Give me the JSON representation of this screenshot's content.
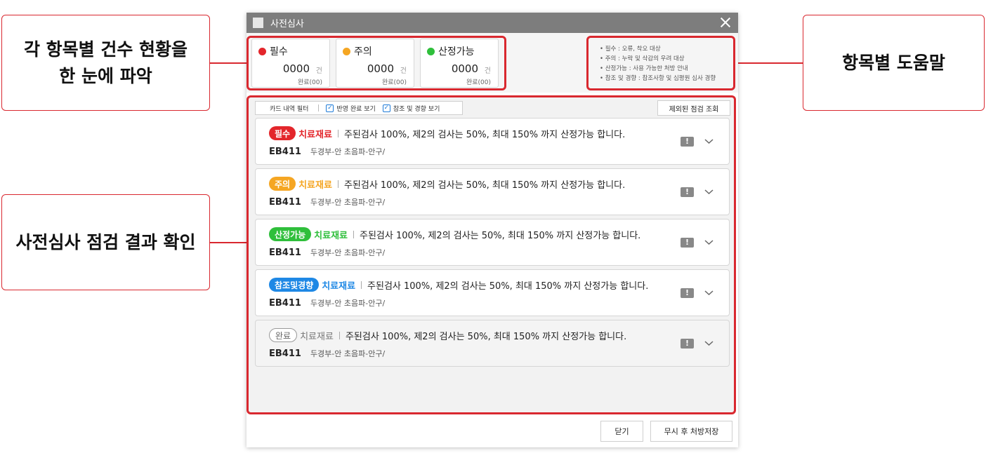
{
  "callouts": {
    "counts": [
      "각 항목별 건수 현황을",
      "한 눈에 파악"
    ],
    "results": "사전심사 점검 결과 확인",
    "help": "항목별 도움말"
  },
  "window": {
    "title": "사전심사"
  },
  "counts": [
    {
      "label": "필수",
      "color": "#e3262b",
      "count": "0000",
      "unit": "건",
      "done": "완료(00)"
    },
    {
      "label": "주의",
      "color": "#f5a623",
      "count": "0000",
      "unit": "건",
      "done": "완료(00)"
    },
    {
      "label": "산정가능",
      "color": "#2fbf3b",
      "count": "0000",
      "unit": "건",
      "done": "완료(00)"
    }
  ],
  "help": [
    "• 필수 : 오류, 착오 대상",
    "• 주의 : 누락 및 삭감의 우려 대상",
    "• 산정가능 : 사용 가능한 처방 안내",
    "• 참조 및 경향 : 참조사항 및 심평원 심사 경향"
  ],
  "filter": {
    "label": "카드 내역 필터",
    "check1": "반영 완료 보기",
    "check2": "참조 및 경향 보기",
    "check_mark": "✓"
  },
  "excluded_button": "제외된 점검 조회",
  "cards": [
    {
      "badge": "필수",
      "badge_color": "#e3262b",
      "cat": "치료재료",
      "cat_color": "#e3262b",
      "msg": "주된검사 100%, 제2의 검사는 50%, 최대 150% 까지 산정가능 합니다.",
      "code": "EB411",
      "desc": "두경부-안 초음파-안구/",
      "alert": "!"
    },
    {
      "badge": "주의",
      "badge_color": "#f5a623",
      "cat": "치료재료",
      "cat_color": "#f5a623",
      "msg": "주된검사 100%, 제2의 검사는 50%, 최대 150% 까지 산정가능 합니다.",
      "code": "EB411",
      "desc": "두경부-안 초음파-안구/",
      "alert": "!"
    },
    {
      "badge": "산정가능",
      "badge_color": "#2fbf3b",
      "cat": "치료재료",
      "cat_color": "#2fbf3b",
      "msg": "주된검사 100%, 제2의 검사는 50%, 최대 150% 까지 산정가능 합니다.",
      "code": "EB411",
      "desc": "두경부-안 초음파-안구/",
      "alert": "!"
    },
    {
      "badge": "참조및경향",
      "badge_color": "#1e88e5",
      "cat": "치료재료",
      "cat_color": "#1e88e5",
      "msg": "주된검사 100%, 제2의 검사는 50%, 최대 150% 까지 산정가능 합니다.",
      "code": "EB411",
      "desc": "두경부-안 초음파-안구/",
      "alert": "!"
    },
    {
      "badge": "완료",
      "badge_color": "#999999",
      "cat": "치료재료",
      "cat_color": "#777777",
      "msg": "주된검사 100%, 제2의 검사는 50%, 최대 150% 까지 산정가능 합니다.",
      "code": "EB411",
      "desc": "두경부-안 초음파-안구/",
      "alert": "!"
    }
  ],
  "buttons": {
    "close": "닫기",
    "save": "무시 후 처방저장"
  }
}
